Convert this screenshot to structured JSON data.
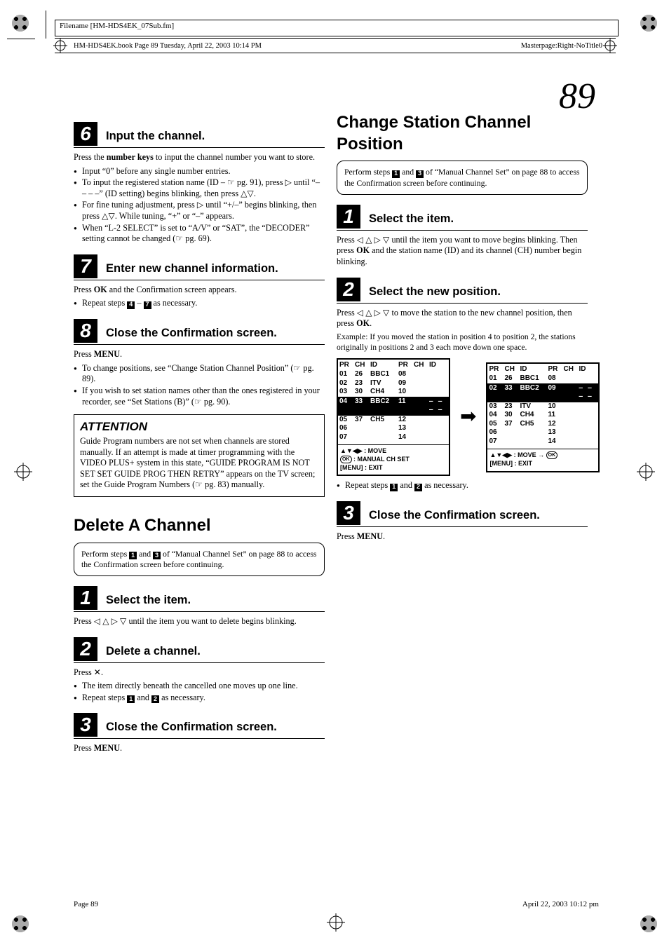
{
  "meta": {
    "filename_label": "Filename [HM-HDS4EK_07Sub.fm]",
    "book_bar": "HM-HDS4EK.book  Page 89  Tuesday, April 22, 2003  10:14 PM",
    "masterpage": "Masterpage:Right-NoTitle0",
    "page_number_large": "89",
    "footer_left": "Page 89",
    "footer_right": "April 22, 2003  10:12 pm"
  },
  "left": {
    "step6": {
      "num": "6",
      "title": "Input the channel.",
      "p1a": "Press the ",
      "p1b": "number keys",
      "p1c": " to input the channel number you want to store.",
      "b1": "Input “0” before any single number entries.",
      "b2": "To input the registered station name (ID – ☞ pg. 91), press ▷ until “– – – –” (ID setting) begins blinking, then press △▽.",
      "b3": "For fine tuning adjustment, press ▷ until “+/–” begins blinking, then press △▽. While tuning, “+” or “–” appears.",
      "b4": "When “L-2 SELECT” is set to “A/V” or “SAT”, the “DECODER” setting cannot be changed (☞ pg. 69)."
    },
    "step7": {
      "num": "7",
      "title": "Enter new channel information.",
      "p1a": "Press ",
      "p1b": "OK",
      "p1c": " and the Confirmation screen appears.",
      "b1a": "Repeat steps ",
      "b1b": " – ",
      "b1c": " as necessary.",
      "ref1": "4",
      "ref2": "7"
    },
    "step8": {
      "num": "8",
      "title": "Close the Confirmation screen.",
      "p1a": "Press ",
      "p1b": "MENU",
      "p1c": ".",
      "b1": "To change positions, see “Change Station Channel Position” (☞ pg. 89).",
      "b2": "If you wish to set station names other than the ones registered in your recorder, see “Set Stations (B)” (☞ pg. 90)."
    },
    "attention": {
      "title": "ATTENTION",
      "body": "Guide Program numbers are not set when channels are stored manually. If an attempt is made at timer programming with the VIDEO PLUS+ system in this state, “GUIDE PROGRAM IS NOT SET SET GUIDE PROG THEN RETRY” appears on the TV screen; set the Guide Program Numbers (☞ pg. 83) manually."
    },
    "delete": {
      "title": "Delete A Channel",
      "note_a": "Perform steps ",
      "note_b": " and ",
      "note_c": " of “Manual Channel Set” on page 88 to access the Confirmation screen before continuing.",
      "ref1": "1",
      "ref3": "3",
      "s1": {
        "num": "1",
        "title": "Select the item.",
        "p": "Press ◁ △ ▷ ▽ until the item you want to delete begins blinking."
      },
      "s2": {
        "num": "2",
        "title": "Delete a channel.",
        "p1": "Press ✕.",
        "b1": "The item directly beneath the cancelled one moves up one line.",
        "b2a": "Repeat steps ",
        "b2b": " and ",
        "b2c": " as necessary.",
        "ref1": "1",
        "ref2": "2"
      },
      "s3": {
        "num": "3",
        "title": "Close the Confirmation screen.",
        "pA": "Press ",
        "pB": "MENU",
        "pC": "."
      }
    }
  },
  "right": {
    "title": "Change Station Channel Position",
    "note_a": "Perform steps ",
    "note_b": " and ",
    "note_c": " of “Manual Channel Set” on page 88 to access the Confirmation screen before continuing.",
    "ref1": "1",
    "ref3": "3",
    "s1": {
      "num": "1",
      "title": "Select the item.",
      "p_a": "Press ◁ △ ▷ ▽ until the item you want to move begins blinking. Then press ",
      "p_b": "OK",
      "p_c": " and the station name (ID) and its channel (CH) number begin blinking."
    },
    "s2": {
      "num": "2",
      "title": "Select the new position.",
      "p_a": "Press ◁ △ ▷ ▽ to move the station to the new channel position, then press ",
      "p_b": "OK",
      "p_c": ".",
      "ex": "Example: If you moved the station in position 4 to position 2, the stations originally in positions 2 and 3 each move down one space.",
      "repeat_a": "Repeat steps ",
      "repeat_b": " and ",
      "repeat_c": " as necessary.",
      "rref1": "1",
      "rref2": "2"
    },
    "s3": {
      "num": "3",
      "title": "Close the Confirmation screen.",
      "pA": "Press ",
      "pB": "MENU",
      "pC": "."
    }
  },
  "chart_data": {
    "type": "table",
    "title": "Channel position before/after move (position 4 → position 2)",
    "headers": [
      "PR",
      "CH",
      "ID",
      "PR",
      "CH",
      "ID"
    ],
    "before": {
      "rows": [
        {
          "PR": "01",
          "CH": "26",
          "ID": "BBC1",
          "PR2": "08",
          "CH2": "",
          "ID2": ""
        },
        {
          "PR": "02",
          "CH": "23",
          "ID": "ITV",
          "PR2": "09",
          "CH2": "",
          "ID2": ""
        },
        {
          "PR": "03",
          "CH": "30",
          "ID": "CH4",
          "PR2": "10",
          "CH2": "",
          "ID2": ""
        },
        {
          "PR": "04",
          "CH": "33",
          "ID": "BBC2",
          "PR2": "11",
          "CH2": "",
          "ID2": "– – – –",
          "selected": true
        },
        {
          "PR": "05",
          "CH": "37",
          "ID": "CH5",
          "PR2": "12",
          "CH2": "",
          "ID2": ""
        },
        {
          "PR": "06",
          "CH": "",
          "ID": "",
          "PR2": "13",
          "CH2": "",
          "ID2": ""
        },
        {
          "PR": "07",
          "CH": "",
          "ID": "",
          "PR2": "14",
          "CH2": "",
          "ID2": ""
        }
      ],
      "legend_line1": "▲▼◀▶ : MOVE",
      "legend_line2": "OK : MANUAL CH SET",
      "legend_line3": "[MENU] : EXIT"
    },
    "after": {
      "rows": [
        {
          "PR": "01",
          "CH": "26",
          "ID": "BBC1",
          "PR2": "08",
          "CH2": "",
          "ID2": ""
        },
        {
          "PR": "02",
          "CH": "33",
          "ID": "BBC2",
          "PR2": "09",
          "CH2": "",
          "ID2": "– – – –",
          "selected": true
        },
        {
          "PR": "03",
          "CH": "23",
          "ID": "ITV",
          "PR2": "10",
          "CH2": "",
          "ID2": ""
        },
        {
          "PR": "04",
          "CH": "30",
          "ID": "CH4",
          "PR2": "11",
          "CH2": "",
          "ID2": ""
        },
        {
          "PR": "05",
          "CH": "37",
          "ID": "CH5",
          "PR2": "12",
          "CH2": "",
          "ID2": ""
        },
        {
          "PR": "06",
          "CH": "",
          "ID": "",
          "PR2": "13",
          "CH2": "",
          "ID2": ""
        },
        {
          "PR": "07",
          "CH": "",
          "ID": "",
          "PR2": "14",
          "CH2": "",
          "ID2": ""
        }
      ],
      "legend_line1": "▲▼◀▶ : MOVE → OK",
      "legend_line2": "[MENU] : EXIT"
    }
  }
}
